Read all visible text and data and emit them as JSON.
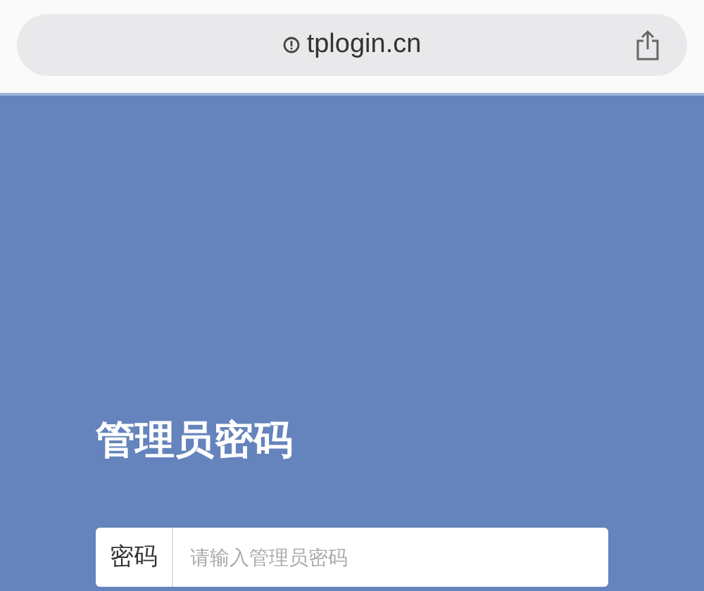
{
  "address_bar": {
    "url": "tplogin.cn"
  },
  "login": {
    "title": "管理员密码",
    "password_field": {
      "label": "密码",
      "placeholder": "请输入管理员密码"
    }
  }
}
